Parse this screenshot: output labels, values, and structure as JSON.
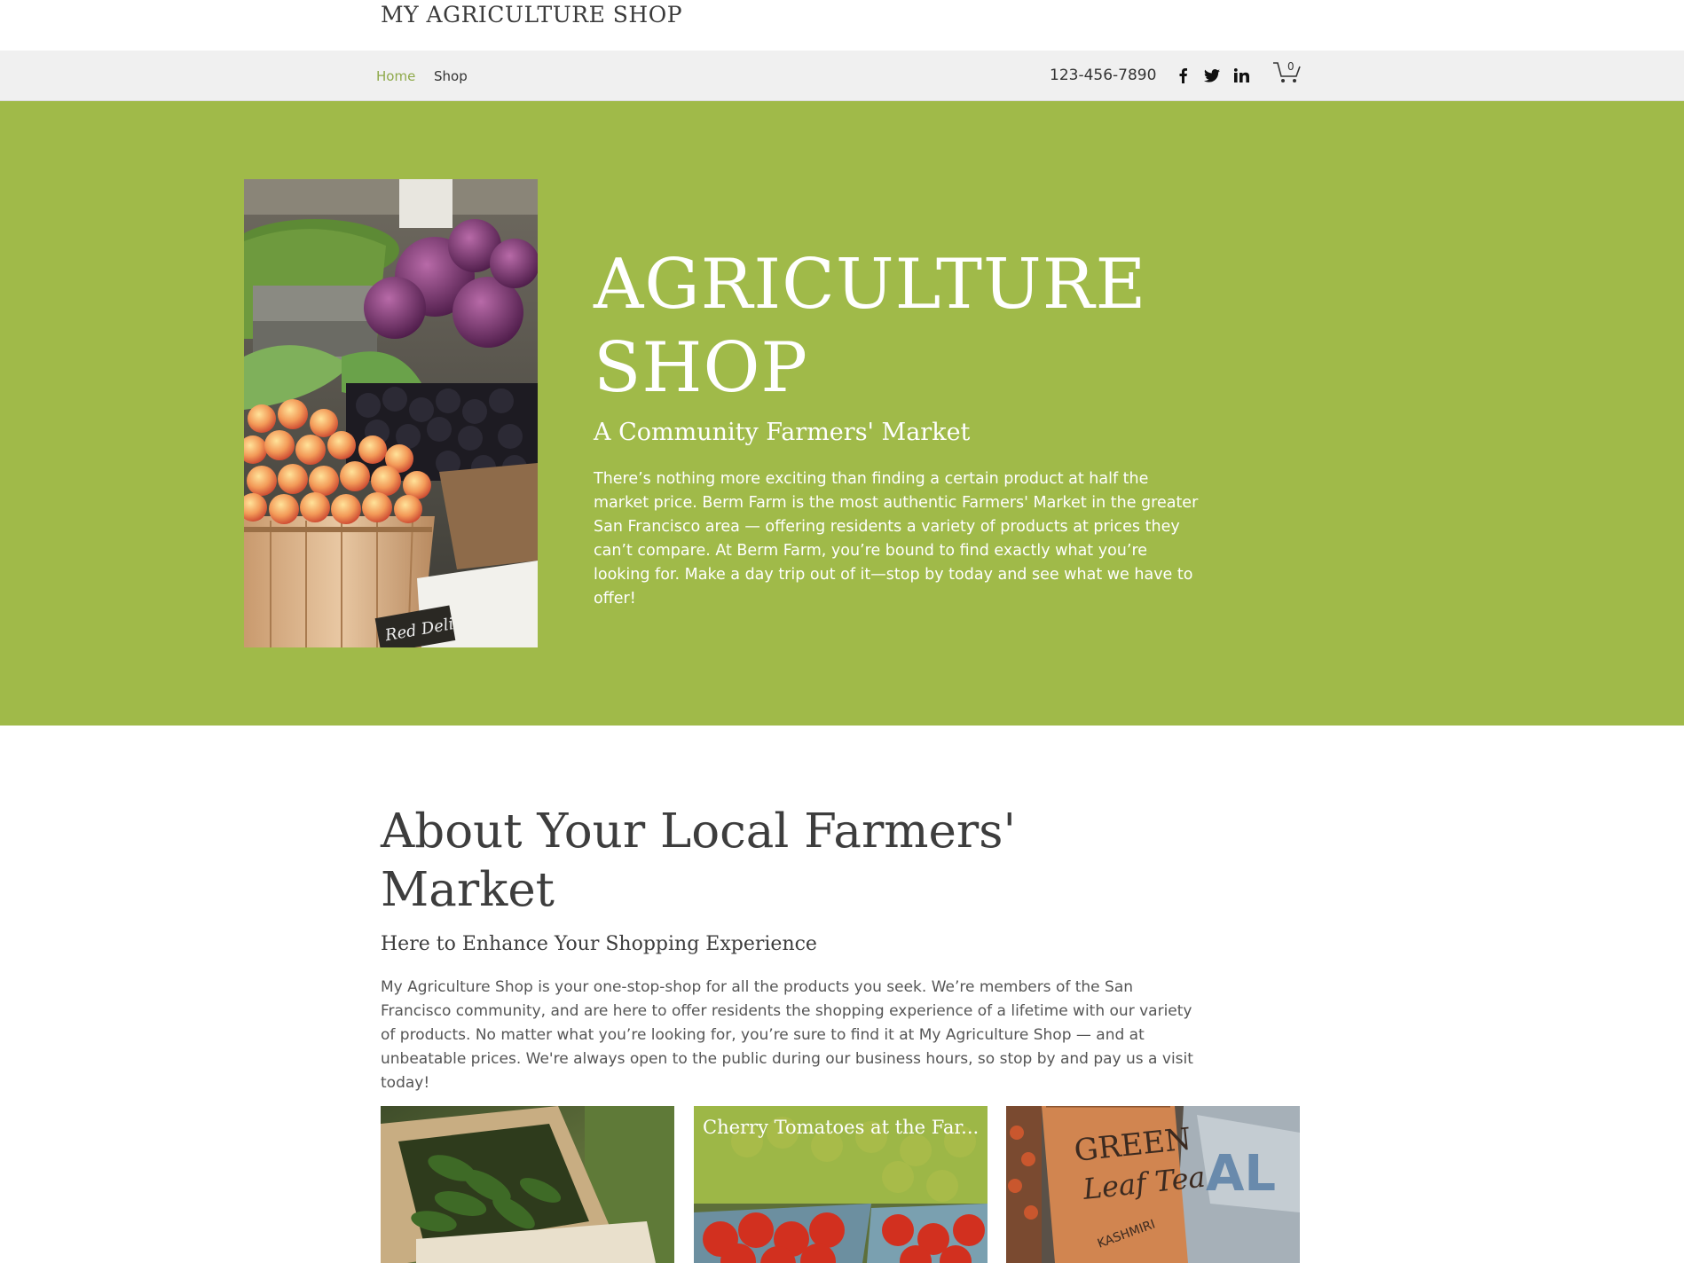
{
  "header": {
    "site_title": "MY AGRICULTURE SHOP"
  },
  "nav": {
    "items": [
      {
        "label": "Home",
        "active": true
      },
      {
        "label": "Shop",
        "active": false
      }
    ],
    "phone": "123-456-7890",
    "social": [
      "facebook-icon",
      "twitter-icon",
      "linkedin-icon"
    ],
    "cart_count": "0"
  },
  "hero": {
    "title_line1": "AGRICULTURE",
    "title_line2": "SHOP",
    "subtitle": "A Community Farmers' Market",
    "text": "There’s nothing more exciting than finding a certain product at half the market price. Berm Farm is the most authentic Farmers' Market in the greater San Francisco area — offering residents a variety of products at prices they can’t compare. At Berm Farm, you’re bound to find exactly what you’re looking for. Make a day trip out of it—stop by today and see what we have to offer!",
    "image_sign_text": "Red Deli",
    "background_color": "#a0ba49"
  },
  "about": {
    "heading_line1": "About Your Local Farmers'",
    "heading_line2": "Market",
    "subheading": "Here to Enhance Your Shopping Experience",
    "text": "My Agriculture Shop is your one-stop-shop for all the products you seek. We’re members of the San Francisco community, and are here to offer residents the shopping experience of a lifetime with our variety of products. No matter what you’re looking for, you’re sure to find it at My Agriculture Shop — and at unbeatable prices. We're always open to the public during our business hours, so stop by and pay us a visit today!"
  },
  "gallery": {
    "items": [
      {
        "caption": ""
      },
      {
        "caption": "Cherry Tomatoes at the Far..."
      },
      {
        "caption": "",
        "sign_line1": "GREEN",
        "sign_line2": "Leaf Tea",
        "sign_line3": "KASHMIRI",
        "bag_text": "AL"
      }
    ]
  }
}
